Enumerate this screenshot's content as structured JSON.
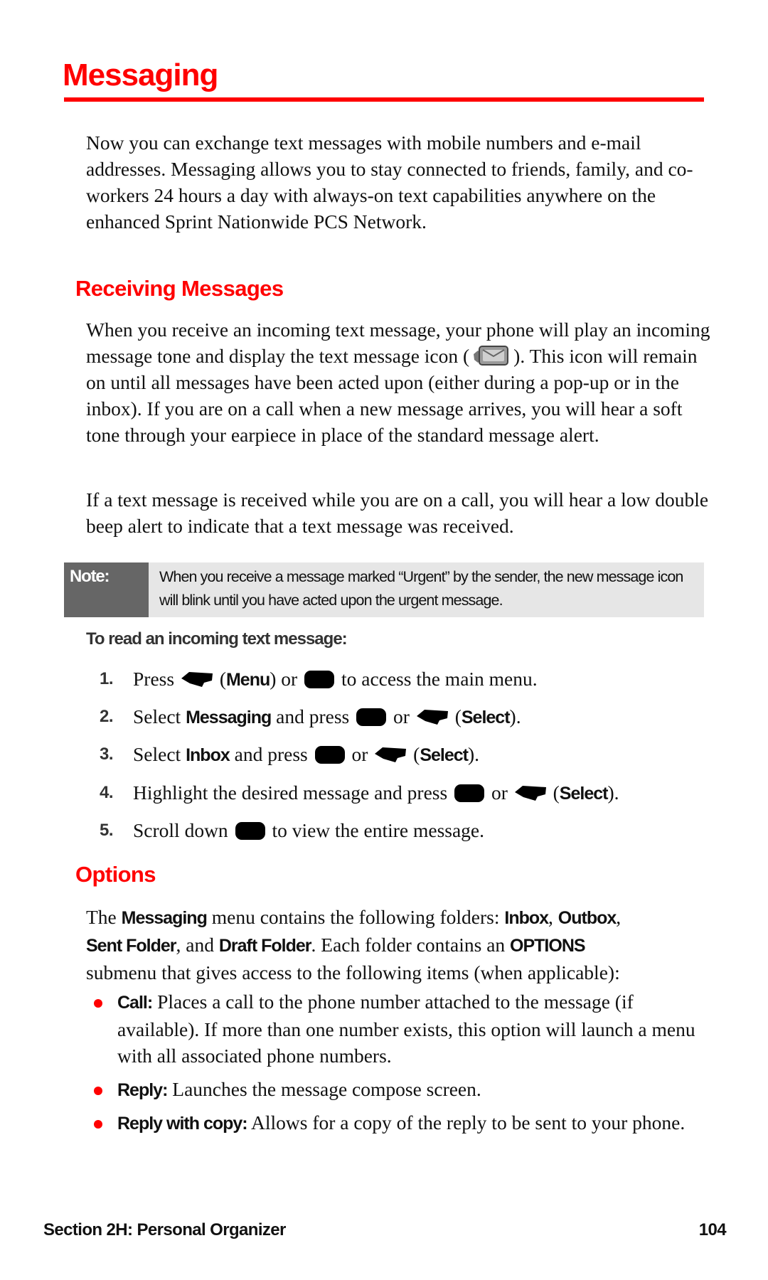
{
  "page": {
    "title": "Messaging",
    "intro": "Now you can exchange text messages with mobile numbers and e-mail addresses. Messaging allows you to stay connected to friends, family, and co-workers 24 hours a day with always-on text capabilities anywhere on the enhanced Sprint Nationwide PCS Network.",
    "accent_color": "#ff0000"
  },
  "receiving": {
    "heading": "Receiving Messages",
    "p1_before_icon": "When you receive an incoming text message, your phone will play an incoming message tone and display the text message icon (",
    "p1_icon": "text-message-icon",
    "p1_after_icon": "). This icon will remain on until all messages have been acted upon (either during a pop-up or in the inbox). If you are on a call when a new message arrives, you will hear a soft tone through your earpiece in place of the standard message alert.",
    "p2": "If a text message is received while you are on a call, you will hear a low double beep alert to indicate that a text message was received."
  },
  "note": {
    "label": "Note:",
    "text": "When you receive a message marked “Urgent” by the sender, the new message icon will blink until you have acted upon the urgent message."
  },
  "procedure": {
    "heading": "To read an incoming text message:",
    "steps": [
      {
        "num": "1.",
        "t1": "Press ",
        "k1": "softkey-icon",
        "t2": " (",
        "b1": "Menu",
        "t3": ") or ",
        "k2": "nav-key-icon",
        "t4": " to access the main menu."
      },
      {
        "num": "2.",
        "t1": "Select ",
        "b1": "Messaging",
        "t2": " and press ",
        "k1": "nav-key-icon",
        "t3": " or ",
        "k2": "softkey-icon",
        "t4": " (",
        "b2": "Select",
        "t5": ")."
      },
      {
        "num": "3.",
        "t1": "Select ",
        "b1": "Inbox",
        "t2": " and press ",
        "k1": "nav-key-icon",
        "t3": " or ",
        "k2": "softkey-icon",
        "t4": " (",
        "b2": "Select",
        "t5": ")."
      },
      {
        "num": "4.",
        "t1": "Highlight the desired message and press ",
        "k1": "nav-key-icon",
        "t2": " or ",
        "k2": "softkey-icon",
        "t3": " (",
        "b1": "Select",
        "t4": ")."
      },
      {
        "num": "5.",
        "t1": "Scroll down ",
        "k1": "nav-key-icon",
        "t2": " to view the entire message."
      }
    ]
  },
  "options": {
    "heading": "Options",
    "intro": {
      "t1": "The ",
      "b1": "Messaging",
      "t2": " menu contains the following folders: ",
      "b2": "Inbox",
      "t3": ", ",
      "b3": "Outbox",
      "t4": ",",
      "b4": "Sent Folder",
      "t5": ", and ",
      "b5": "Draft Folder",
      "t6": ". Each folder contains an ",
      "b6": "OPTIONS",
      "t7": "submenu that gives access to the following items (when applicable):"
    },
    "items": [
      {
        "label": "Call:",
        "text": " Places a call to the phone number attached to the message (if available). If more than one number exists, this option will launch a menu with all associated phone numbers."
      },
      {
        "label": "Reply:",
        "text": " Launches the message compose screen."
      },
      {
        "label": "Reply with copy:",
        "text": " Allows for a copy of the reply to be sent to your phone."
      }
    ]
  },
  "footer": {
    "section": "Section 2H: Personal Organizer",
    "page_number": "104"
  }
}
